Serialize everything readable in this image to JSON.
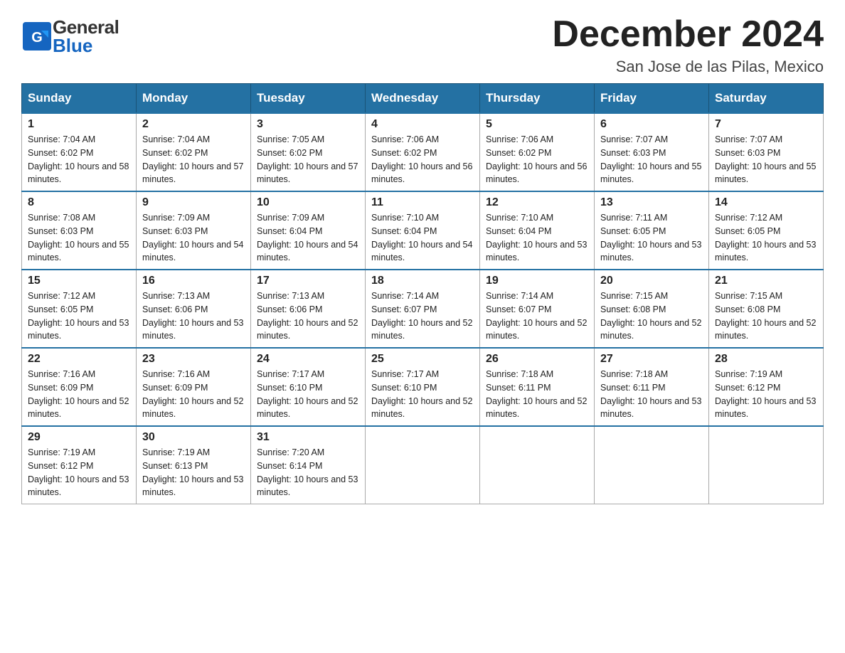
{
  "header": {
    "logo": {
      "general": "General",
      "blue": "Blue"
    },
    "title": "December 2024",
    "location": "San Jose de las Pilas, Mexico"
  },
  "weekdays": [
    "Sunday",
    "Monday",
    "Tuesday",
    "Wednesday",
    "Thursday",
    "Friday",
    "Saturday"
  ],
  "weeks": [
    [
      {
        "day": "1",
        "sunrise": "7:04 AM",
        "sunset": "6:02 PM",
        "daylight": "10 hours and 58 minutes."
      },
      {
        "day": "2",
        "sunrise": "7:04 AM",
        "sunset": "6:02 PM",
        "daylight": "10 hours and 57 minutes."
      },
      {
        "day": "3",
        "sunrise": "7:05 AM",
        "sunset": "6:02 PM",
        "daylight": "10 hours and 57 minutes."
      },
      {
        "day": "4",
        "sunrise": "7:06 AM",
        "sunset": "6:02 PM",
        "daylight": "10 hours and 56 minutes."
      },
      {
        "day": "5",
        "sunrise": "7:06 AM",
        "sunset": "6:02 PM",
        "daylight": "10 hours and 56 minutes."
      },
      {
        "day": "6",
        "sunrise": "7:07 AM",
        "sunset": "6:03 PM",
        "daylight": "10 hours and 55 minutes."
      },
      {
        "day": "7",
        "sunrise": "7:07 AM",
        "sunset": "6:03 PM",
        "daylight": "10 hours and 55 minutes."
      }
    ],
    [
      {
        "day": "8",
        "sunrise": "7:08 AM",
        "sunset": "6:03 PM",
        "daylight": "10 hours and 55 minutes."
      },
      {
        "day": "9",
        "sunrise": "7:09 AM",
        "sunset": "6:03 PM",
        "daylight": "10 hours and 54 minutes."
      },
      {
        "day": "10",
        "sunrise": "7:09 AM",
        "sunset": "6:04 PM",
        "daylight": "10 hours and 54 minutes."
      },
      {
        "day": "11",
        "sunrise": "7:10 AM",
        "sunset": "6:04 PM",
        "daylight": "10 hours and 54 minutes."
      },
      {
        "day": "12",
        "sunrise": "7:10 AM",
        "sunset": "6:04 PM",
        "daylight": "10 hours and 53 minutes."
      },
      {
        "day": "13",
        "sunrise": "7:11 AM",
        "sunset": "6:05 PM",
        "daylight": "10 hours and 53 minutes."
      },
      {
        "day": "14",
        "sunrise": "7:12 AM",
        "sunset": "6:05 PM",
        "daylight": "10 hours and 53 minutes."
      }
    ],
    [
      {
        "day": "15",
        "sunrise": "7:12 AM",
        "sunset": "6:05 PM",
        "daylight": "10 hours and 53 minutes."
      },
      {
        "day": "16",
        "sunrise": "7:13 AM",
        "sunset": "6:06 PM",
        "daylight": "10 hours and 53 minutes."
      },
      {
        "day": "17",
        "sunrise": "7:13 AM",
        "sunset": "6:06 PM",
        "daylight": "10 hours and 52 minutes."
      },
      {
        "day": "18",
        "sunrise": "7:14 AM",
        "sunset": "6:07 PM",
        "daylight": "10 hours and 52 minutes."
      },
      {
        "day": "19",
        "sunrise": "7:14 AM",
        "sunset": "6:07 PM",
        "daylight": "10 hours and 52 minutes."
      },
      {
        "day": "20",
        "sunrise": "7:15 AM",
        "sunset": "6:08 PM",
        "daylight": "10 hours and 52 minutes."
      },
      {
        "day": "21",
        "sunrise": "7:15 AM",
        "sunset": "6:08 PM",
        "daylight": "10 hours and 52 minutes."
      }
    ],
    [
      {
        "day": "22",
        "sunrise": "7:16 AM",
        "sunset": "6:09 PM",
        "daylight": "10 hours and 52 minutes."
      },
      {
        "day": "23",
        "sunrise": "7:16 AM",
        "sunset": "6:09 PM",
        "daylight": "10 hours and 52 minutes."
      },
      {
        "day": "24",
        "sunrise": "7:17 AM",
        "sunset": "6:10 PM",
        "daylight": "10 hours and 52 minutes."
      },
      {
        "day": "25",
        "sunrise": "7:17 AM",
        "sunset": "6:10 PM",
        "daylight": "10 hours and 52 minutes."
      },
      {
        "day": "26",
        "sunrise": "7:18 AM",
        "sunset": "6:11 PM",
        "daylight": "10 hours and 52 minutes."
      },
      {
        "day": "27",
        "sunrise": "7:18 AM",
        "sunset": "6:11 PM",
        "daylight": "10 hours and 53 minutes."
      },
      {
        "day": "28",
        "sunrise": "7:19 AM",
        "sunset": "6:12 PM",
        "daylight": "10 hours and 53 minutes."
      }
    ],
    [
      {
        "day": "29",
        "sunrise": "7:19 AM",
        "sunset": "6:12 PM",
        "daylight": "10 hours and 53 minutes."
      },
      {
        "day": "30",
        "sunrise": "7:19 AM",
        "sunset": "6:13 PM",
        "daylight": "10 hours and 53 minutes."
      },
      {
        "day": "31",
        "sunrise": "7:20 AM",
        "sunset": "6:14 PM",
        "daylight": "10 hours and 53 minutes."
      },
      null,
      null,
      null,
      null
    ]
  ],
  "labels": {
    "sunrise": "Sunrise:",
    "sunset": "Sunset:",
    "daylight": "Daylight:"
  }
}
